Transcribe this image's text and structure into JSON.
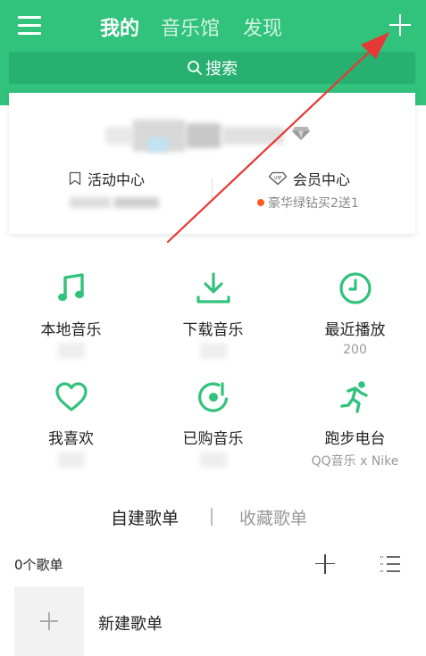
{
  "header": {
    "tabs": [
      {
        "label": "我的",
        "active": true
      },
      {
        "label": "音乐馆",
        "active": false
      },
      {
        "label": "发现",
        "active": false
      }
    ],
    "menu_icon": "hamburger-menu-icon",
    "add_icon": "plus-icon"
  },
  "search": {
    "label": "搜索",
    "icon": "search-icon"
  },
  "profile": {
    "activity_center": {
      "label": "活动中心",
      "icon": "bookmark-icon"
    },
    "vip_center": {
      "label": "会员中心",
      "icon": "vip-icon",
      "promo": "豪华绿钻买2送1"
    }
  },
  "quick_grid": [
    {
      "label": "本地音乐",
      "sub": "",
      "icon": "music-note-icon"
    },
    {
      "label": "下载音乐",
      "sub": "",
      "icon": "download-icon"
    },
    {
      "label": "最近播放",
      "sub": "200",
      "icon": "clock-icon"
    },
    {
      "label": "我喜欢",
      "sub": "",
      "icon": "heart-icon"
    },
    {
      "label": "已购音乐",
      "sub": "",
      "icon": "disc-icon"
    },
    {
      "label": "跑步电台",
      "sub": "QQ音乐 x Nike",
      "icon": "runner-icon"
    }
  ],
  "playlists": {
    "tabs": [
      {
        "label": "自建歌单",
        "active": true
      },
      {
        "label": "收藏歌单",
        "active": false
      }
    ],
    "count": "0个歌单",
    "new_playlist_label": "新建歌单"
  },
  "colors": {
    "brand_green": "#31c27c",
    "search_green": "#27b06f",
    "annotation_arrow": "#e53935",
    "promo_dot": "#ff5a1f"
  }
}
